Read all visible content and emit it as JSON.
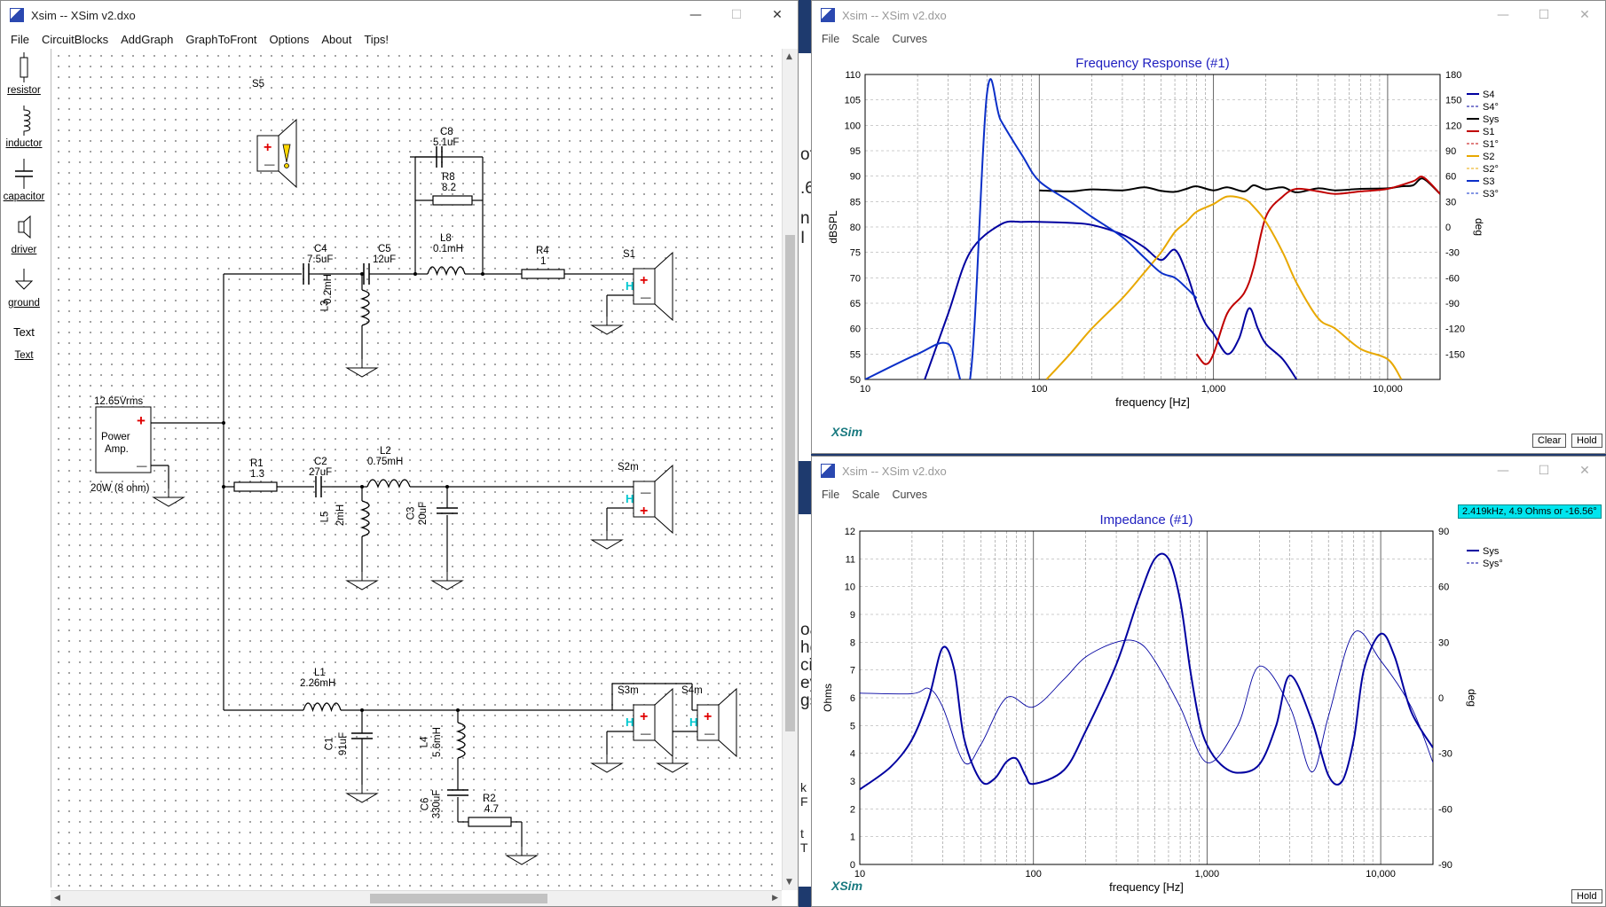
{
  "schematic_window": {
    "title": "Xsim -- XSim v2.dxo",
    "menu": [
      "File",
      "CircuitBlocks",
      "AddGraph",
      "GraphToFront",
      "Options",
      "About",
      "Tips!"
    ],
    "tools": [
      "resistor",
      "inductor",
      "capacitor",
      "driver",
      "ground",
      "Text",
      "Text"
    ],
    "components": {
      "S5": "S5",
      "S1": "S1",
      "S2m": "S2m",
      "S3m": "S3m",
      "S4m": "S4m",
      "C8": {
        "name": "C8",
        "value": "5.1uF"
      },
      "R8": {
        "name": "R8",
        "value": "8.2"
      },
      "L8": {
        "name": "L8",
        "value": "0.1mH"
      },
      "C4": {
        "name": "C4",
        "value": "7.5uF"
      },
      "C5": {
        "name": "C5",
        "value": "12uF"
      },
      "R4": {
        "name": "R4",
        "value": "1"
      },
      "L3": {
        "name": "L3",
        "value": "0.2mH"
      },
      "R1": {
        "name": "R1",
        "value": "1.3"
      },
      "C2": {
        "name": "C2",
        "value": "27uF"
      },
      "L2": {
        "name": "L2",
        "value": "0.75mH"
      },
      "L5": {
        "name": "L5",
        "value": "2mH"
      },
      "C3": {
        "name": "C3",
        "value": "20uF"
      },
      "L1": {
        "name": "L1",
        "value": "2.26mH"
      },
      "C1": {
        "name": "C1",
        "value": "91uF"
      },
      "L4": {
        "name": "L4",
        "value": "5.6mH"
      },
      "C6": {
        "name": "C6",
        "value": "330uF"
      },
      "R2": {
        "name": "R2",
        "value": "4.7"
      },
      "amp": {
        "voltage": "12.65Vrms",
        "line1": "Power",
        "line2": "Amp.",
        "rating": "20W (8 ohm)"
      }
    }
  },
  "freq_window": {
    "title": "Xsim -- XSim v2.dxo",
    "menu": [
      "File",
      "Scale",
      "Curves"
    ],
    "brand": "XSim",
    "clear_label": "Clear",
    "hold_label": "Hold"
  },
  "imp_window": {
    "title": "Xsim -- XSim v2.dxo",
    "menu": [
      "File",
      "Scale",
      "Curves"
    ],
    "brand": "XSim",
    "hold_label": "Hold",
    "tooltip": "2.419kHz, 4.9 Ohms or -16.56°"
  },
  "background_fragments": [
    "ot",
    ".6",
    "n I",
    "oa",
    "he",
    "cic",
    "ey",
    "gs",
    "k F",
    "t T"
  ],
  "colors": {
    "navy": "#0000a0",
    "black": "#000000",
    "red": "#c00000",
    "gold": "#e8a800",
    "blue": "#0b2fc8",
    "gray_purple": "#8080b0",
    "title_blue": "#2020c0",
    "brand_teal": "#1a7a80"
  },
  "chart_data": [
    {
      "type": "line",
      "title": "Frequency Response (#1)",
      "xlabel": "frequency [Hz]",
      "ylabel": "dBSPL",
      "y2label": "deg",
      "x_scale": "log",
      "xlim": [
        10,
        20000
      ],
      "ylim": [
        50,
        110
      ],
      "y2lim": [
        -180,
        180
      ],
      "x_tick_labels": [
        "10",
        "100",
        "1,000",
        "10,000"
      ],
      "y_ticks": [
        50,
        55,
        60,
        65,
        70,
        75,
        80,
        85,
        90,
        95,
        100,
        105,
        110
      ],
      "y2_ticks": [
        -150,
        -120,
        -90,
        -60,
        -30,
        0,
        30,
        60,
        90,
        120,
        150,
        180
      ],
      "grid": true,
      "legend_position": "right",
      "series": [
        {
          "name": "Sys",
          "color": "#000000",
          "x": [
            100,
            150,
            200,
            300,
            400,
            500,
            600,
            700,
            800,
            1000,
            1200,
            1500,
            1700,
            2000,
            2500,
            3000,
            4000,
            5000,
            7000,
            10000,
            12000,
            14000,
            16000,
            20000
          ],
          "y": [
            87.2,
            87.0,
            87.4,
            87.2,
            87.8,
            87.1,
            86.9,
            87.5,
            88.0,
            87.2,
            87.8,
            87.0,
            88.2,
            87.4,
            87.8,
            86.8,
            87.6,
            87.2,
            87.5,
            87.6,
            88.0,
            88.2,
            89.5,
            86.5
          ]
        },
        {
          "name": "S4",
          "color": "#0000a0",
          "x": [
            22,
            30,
            40,
            60,
            80,
            100,
            150,
            200,
            300,
            400,
            500,
            600,
            700,
            800,
            900,
            1000,
            1200,
            1400,
            1600,
            1800,
            2000,
            2500,
            3000
          ],
          "y": [
            50,
            63,
            75,
            80.5,
            81,
            81,
            80.8,
            80.4,
            78.5,
            76,
            73.5,
            75.5,
            71,
            65,
            61,
            59,
            55,
            58,
            64,
            60,
            57,
            54,
            50
          ]
        },
        {
          "name": "S1",
          "color": "#c00000",
          "x": [
            800,
            900,
            1000,
            1200,
            1500,
            1700,
            2000,
            2500,
            3000,
            4000,
            5000,
            7000,
            10000,
            14000,
            16000,
            20000
          ],
          "y": [
            55,
            53,
            55,
            63,
            67,
            72,
            82,
            86,
            87.5,
            87,
            86.5,
            87,
            87.5,
            89,
            89.8,
            86.5
          ]
        },
        {
          "name": "S2",
          "color": "#e8a800",
          "x": [
            110,
            150,
            200,
            300,
            400,
            500,
            600,
            700,
            800,
            1000,
            1200,
            1500,
            1700,
            2000,
            2500,
            3000,
            4000,
            5000,
            7000,
            10000,
            12000
          ],
          "y": [
            50,
            55,
            60,
            66,
            71,
            75,
            79,
            81,
            83,
            84.5,
            86,
            85.5,
            84,
            81,
            75,
            69,
            62,
            60,
            56,
            54,
            50
          ]
        },
        {
          "name": "S3",
          "color": "#0b2fc8",
          "x": [
            10,
            20,
            30,
            40,
            50,
            60,
            80,
            100,
            150,
            200,
            300,
            400,
            500,
            600,
            700,
            800
          ],
          "y": [
            50,
            55,
            57,
            50,
            106,
            101,
            94,
            89,
            85,
            82,
            78,
            74,
            71,
            70,
            68,
            66
          ]
        }
      ]
    },
    {
      "type": "line",
      "title": "Impedance (#1)",
      "xlabel": "frequency [Hz]",
      "ylabel": "Ohms",
      "y2label": "deg",
      "x_scale": "log",
      "xlim": [
        10,
        20000
      ],
      "ylim": [
        0,
        12
      ],
      "y2lim": [
        -90,
        90
      ],
      "x_tick_labels": [
        "10",
        "100",
        "1,000",
        "10,000"
      ],
      "y_ticks": [
        0,
        1,
        2,
        3,
        4,
        5,
        6,
        7,
        8,
        9,
        10,
        11,
        12
      ],
      "y2_ticks": [
        -90,
        -60,
        -30,
        0,
        30,
        60,
        90
      ],
      "grid": true,
      "legend_position": "top-right",
      "series": [
        {
          "name": "Sys",
          "color": "#0000a0",
          "x": [
            10,
            15,
            20,
            25,
            30,
            35,
            40,
            50,
            60,
            70,
            80,
            90,
            100,
            150,
            200,
            300,
            400,
            500,
            600,
            700,
            800,
            900,
            1000,
            1200,
            1500,
            2000,
            2500,
            3000,
            4000,
            5000,
            6000,
            7000,
            8000,
            10000,
            12000,
            15000,
            20000
          ],
          "y": [
            2.7,
            3.5,
            4.5,
            6.0,
            7.8,
            7.0,
            4.5,
            3.0,
            3.1,
            3.7,
            3.8,
            3.2,
            2.9,
            3.4,
            4.8,
            7.2,
            9.5,
            11.0,
            11.0,
            9.5,
            7.0,
            5.2,
            4.3,
            3.6,
            3.3,
            3.6,
            5.0,
            6.8,
            5.2,
            3.2,
            3.0,
            4.5,
            7.0,
            8.3,
            7.5,
            5.5,
            4.2
          ]
        },
        {
          "name": "Sys°",
          "color": "#0000a0",
          "x": [
            10,
            20,
            25,
            30,
            40,
            50,
            70,
            100,
            150,
            200,
            300,
            400,
            500,
            700,
            1000,
            1500,
            2000,
            3000,
            4000,
            5000,
            7000,
            10000,
            15000,
            20000
          ],
          "y": [
            2.5,
            2.2,
            5.0,
            -5.0,
            -35.0,
            -25.0,
            0.0,
            -5.0,
            10.0,
            22.0,
            30.0,
            30.0,
            20.0,
            -5.0,
            -35.0,
            -15.0,
            17.0,
            -5.0,
            -40.0,
            -10.0,
            35.0,
            20.0,
            -5.0,
            -35.0
          ]
        }
      ]
    }
  ]
}
